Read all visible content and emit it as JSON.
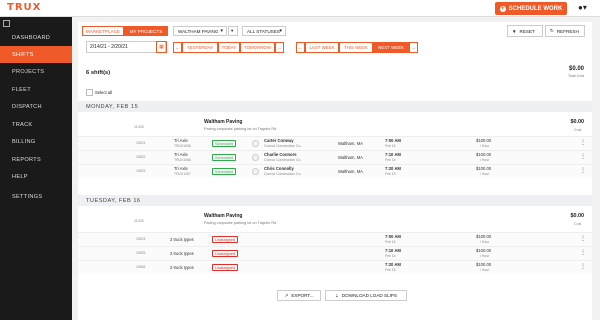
{
  "app": {
    "logo": "TRUX",
    "schedule_button": "SCHEDULE WORK",
    "user_icon": "user-icon"
  },
  "sidebar": {
    "items": [
      "DASHBOARD",
      "SHIFTS",
      "PROJECTS",
      "FLEET",
      "DISPATCH",
      "TRACK",
      "BILLING",
      "REPORTS",
      "HELP",
      "SETTINGS"
    ],
    "active": "SHIFTS"
  },
  "filters": {
    "marketplace": "MARKETPLACE",
    "my_projects": "MY PROJECTS",
    "location": "WALTHAM PAVING",
    "statuses": "ALL STATUSES",
    "reset": "RESET",
    "refresh": "REFRESH",
    "date_range": "2/14/21 - 2/20/21",
    "yesterday": "YESTERDAY",
    "today": "TODAY",
    "tomorrow": "TOMORROW",
    "last_week": "LAST WEEK",
    "this_week": "THIS WEEK",
    "next_week": "NEXT WEEK"
  },
  "summary": {
    "count": "6 shift(s)",
    "total": "$0.00",
    "total_label": "Total Cost",
    "select_all": "Select all"
  },
  "days": [
    {
      "header": "MONDAY, FEB 15",
      "job": {
        "id": "11330",
        "title": "Waltham Paving",
        "subtitle": "Paving corporate parking lot on Trapelo Rd",
        "amount": "$0.00",
        "amount_label": "Cost"
      },
      "rows": [
        {
          "ref": "15521",
          "truck": "Tri Axle",
          "truck_id": "TRUX1066",
          "status": "Scheduled",
          "driver": "Carter Conway",
          "company": "Conrod Construction Co.",
          "location": "Waltham, MA",
          "time": "7:00 AM",
          "date": "Feb 15",
          "rate": "$100.00",
          "rate_unit": "/ Hour"
        },
        {
          "ref": "15522",
          "truck": "Tri Axle",
          "truck_id": "TRUX1066",
          "status": "Scheduled",
          "driver": "Charlie Connors",
          "company": "Conrod Construction Co.",
          "location": "Waltham, MA",
          "time": "7:10 AM",
          "date": "Feb 15",
          "rate": "$100.00",
          "rate_unit": "/ Hour"
        },
        {
          "ref": "15523",
          "truck": "Tri Axle",
          "truck_id": "TRUX1067",
          "status": "Scheduled",
          "driver": "Chris Connolly",
          "company": "Conrod Construction Co.",
          "location": "Waltham, MA",
          "time": "7:20 AM",
          "date": "Feb 15",
          "rate": "$100.00",
          "rate_unit": "/ Hour"
        }
      ]
    },
    {
      "header": "TUESDAY, FEB 16",
      "job": {
        "id": "11330",
        "title": "Waltham Paving",
        "subtitle": "Paving corporate parking lot on Trapelo Rd",
        "amount": "$0.00",
        "amount_label": "Cost"
      },
      "rows": [
        {
          "ref": "15524",
          "truck": "2 truck types",
          "status": "Unassigned",
          "time": "7:00 AM",
          "date": "Feb 16",
          "rate": "$100.00",
          "rate_unit": "/ Hour"
        },
        {
          "ref": "15525",
          "truck": "2 truck types",
          "status": "Unassigned",
          "time": "7:10 AM",
          "date": "Feb 16",
          "rate": "$100.00",
          "rate_unit": "/ Hour"
        },
        {
          "ref": "15526",
          "truck": "2 truck types",
          "status": "Unassigned",
          "time": "7:20 AM",
          "date": "Feb 16",
          "rate": "$100.00",
          "rate_unit": "/ Hour"
        }
      ]
    }
  ],
  "footer": {
    "export": "EXPORT...",
    "download": "DOWNLOAD LOAD SLIPS"
  }
}
